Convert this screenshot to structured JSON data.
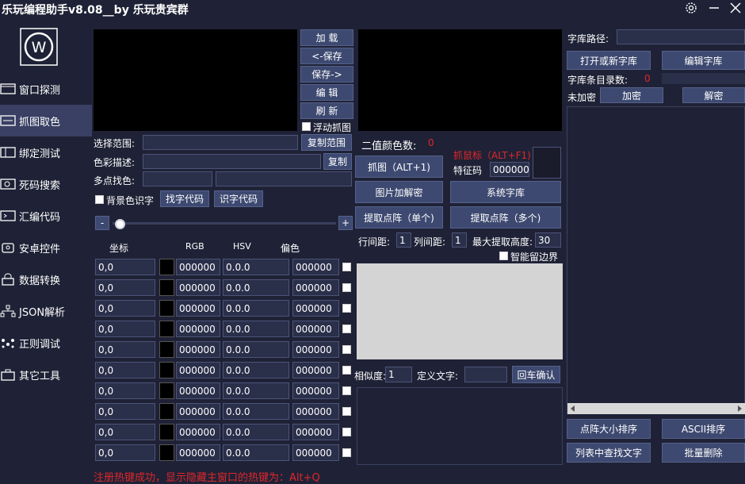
{
  "window": {
    "title": "乐玩编程助手v8.08__by 乐玩贵宾群"
  },
  "sidebar": {
    "items": [
      {
        "label": "窗口探测",
        "icon": "window-icon"
      },
      {
        "label": "抓图取色",
        "icon": "screenshot-icon"
      },
      {
        "label": "绑定测试",
        "icon": "bind-icon"
      },
      {
        "label": "死码搜索",
        "icon": "search-icon"
      },
      {
        "label": "汇编代码",
        "icon": "code-icon"
      },
      {
        "label": "安卓控件",
        "icon": "android-icon"
      },
      {
        "label": "数据转换",
        "icon": "lock-icon"
      },
      {
        "label": "JSON解析",
        "icon": "tree-icon"
      },
      {
        "label": "正则调试",
        "icon": "regex-icon"
      },
      {
        "label": "其它工具",
        "icon": "toolbox-icon"
      }
    ],
    "active_index": 1
  },
  "capture": {
    "buttons": [
      "加 载",
      "<-保存",
      "保存->",
      "编 辑",
      "刷 新"
    ],
    "float_label": "浮动抓图"
  },
  "range": {
    "label": "选择范围:",
    "copy_btn": "复制范围"
  },
  "color_desc": {
    "label": "色彩描述:",
    "copy_btn": "复制"
  },
  "multi_color": {
    "label": "多点找色:"
  },
  "bg_ocr": {
    "label": "背景色识字",
    "find_btn": "找字代码",
    "recog_btn": "识字代码"
  },
  "slider": {
    "minus": "-",
    "plus": "+"
  },
  "table": {
    "headers": [
      "坐标",
      "RGB",
      "HSV",
      "偏色"
    ],
    "rows": [
      {
        "coord": "0,0",
        "rgb": "000000",
        "hsv": "0.0.0",
        "offset": "000000"
      },
      {
        "coord": "0,0",
        "rgb": "000000",
        "hsv": "0.0.0",
        "offset": "000000"
      },
      {
        "coord": "0,0",
        "rgb": "000000",
        "hsv": "0.0.0",
        "offset": "000000"
      },
      {
        "coord": "0,0",
        "rgb": "000000",
        "hsv": "0.0.0",
        "offset": "000000"
      },
      {
        "coord": "0,0",
        "rgb": "000000",
        "hsv": "0.0.0",
        "offset": "000000"
      },
      {
        "coord": "0,0",
        "rgb": "000000",
        "hsv": "0.0.0",
        "offset": "000000"
      },
      {
        "coord": "0,0",
        "rgb": "000000",
        "hsv": "0.0.0",
        "offset": "000000"
      },
      {
        "coord": "0,0",
        "rgb": "000000",
        "hsv": "0.0.0",
        "offset": "000000"
      },
      {
        "coord": "0,0",
        "rgb": "000000",
        "hsv": "0.0.0",
        "offset": "000000"
      },
      {
        "coord": "0,0",
        "rgb": "000000",
        "hsv": "0.0.0",
        "offset": "000000"
      }
    ]
  },
  "binary": {
    "count_label": "二值颜色数:",
    "count_value": "0",
    "grab_btn": "抓图（ALT+1)",
    "mouse_label": "抓鼠标（ALT+F1)",
    "feature_label": "特征码",
    "feature_value": "000000",
    "decrypt_btn": "图片加解密",
    "syslib_btn": "系统字库",
    "extract_single_btn": "提取点阵（单个)",
    "extract_multi_btn": "提取点阵（多个)",
    "row_spacing_label": "行间距:",
    "row_spacing": "1",
    "col_spacing_label": "列间距:",
    "col_spacing": "1",
    "max_height_label": "最大提取高度:",
    "max_height": "30",
    "smart_border_label": "智能留边界",
    "similarity_label": "相似度:",
    "similarity": "1",
    "define_text_label": "定义文字:",
    "define_text": "",
    "confirm_btn": "回车确认"
  },
  "library": {
    "path_label": "字库路径:",
    "path_value": "",
    "open_btn": "打开或新字库",
    "edit_btn": "编辑字库",
    "count_label": "字库条目录数:",
    "count_value": "0",
    "encrypt_status": "未加密",
    "encrypt_btn": "加密",
    "decrypt_btn": "解密",
    "sort_size_btn": "点阵大小排序",
    "sort_ascii_btn": "ASCII排序",
    "find_text_btn": "列表中查找文字",
    "batch_delete_btn": "批量删除"
  },
  "status": {
    "message": "注册热键成功，显示隐藏主窗口的热键为：Alt+Q"
  },
  "colors": {
    "background": "#1f2236",
    "button": "#3d4970",
    "accent_red": "#e0262b"
  }
}
